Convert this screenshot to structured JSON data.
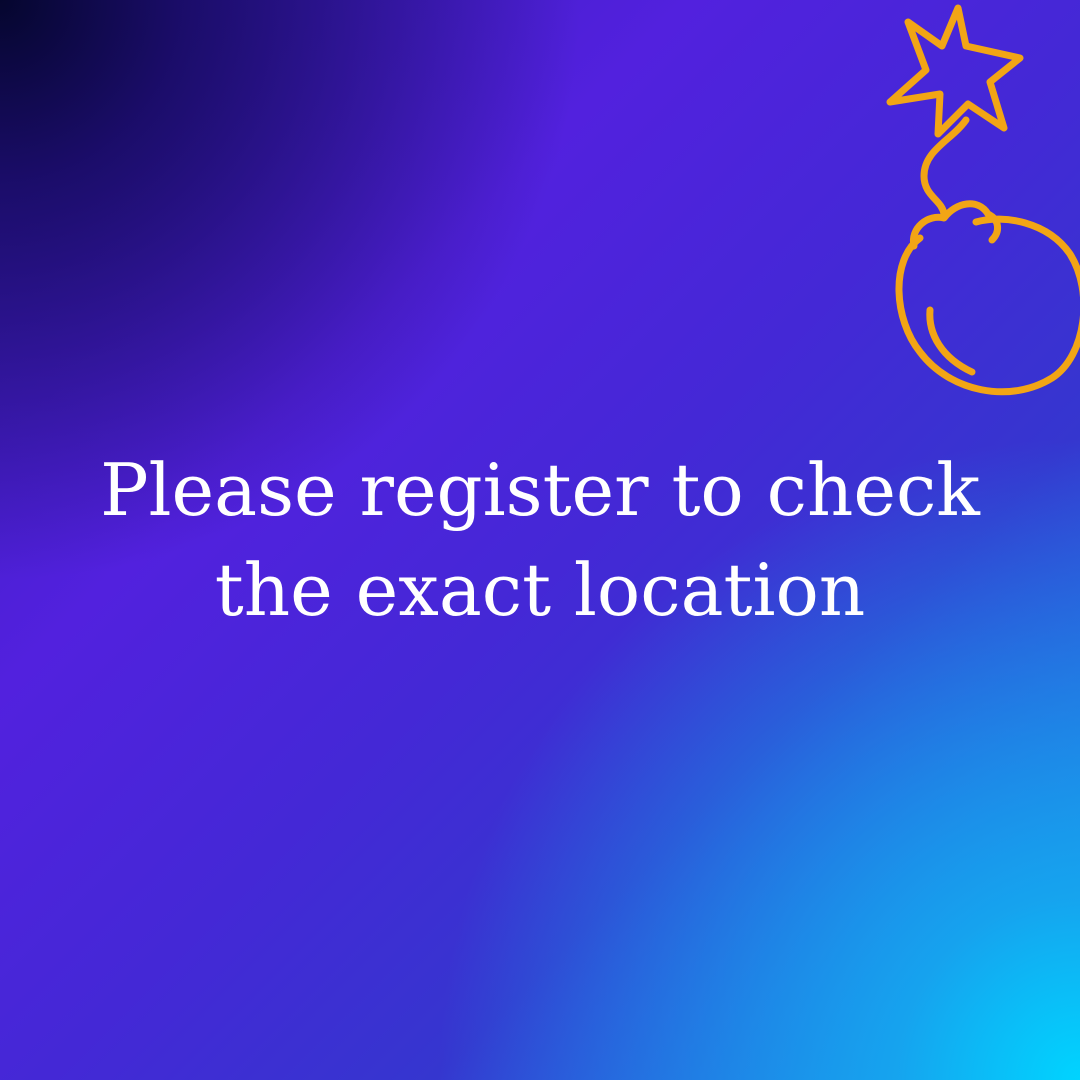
{
  "message": {
    "line1": "Please register to check",
    "line2": "the exact location"
  },
  "decoration": {
    "icon": "bomb-with-star-spark-icon",
    "color": "#f2a515"
  },
  "colors": {
    "text": "#ffffff",
    "gradient": [
      "#05062e",
      "#5221de",
      "#3536cf",
      "#00d4ff"
    ]
  }
}
